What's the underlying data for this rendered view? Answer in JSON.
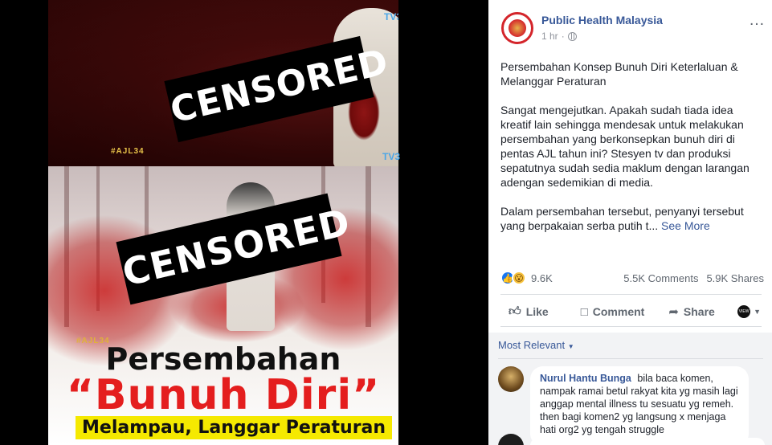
{
  "media": {
    "censor_top": "CENSORED",
    "censor_bottom": "CENSORED",
    "hashtag_top": "#AJL34",
    "hashtag_bottom": "#AJL34",
    "tv_logo": "TV3",
    "headline_line1": "Persembahan",
    "headline_line2": "“Bunuh Diri”",
    "headline_line3": "Melampau, Langgar Peraturan"
  },
  "post": {
    "page_name": "Public Health Malaysia",
    "time": "1 hr",
    "time_separator": "·",
    "more_icon": "…",
    "body_paragraphs": [
      "Persembahan Konsep Bunuh Diri Keterlaluan & Melanggar Peraturan",
      "Sangat mengejutkan. Apakah sudah tiada idea kreatif lain sehingga mendesak untuk melakukan persembahan yang berkonsepkan bunuh diri di pentas AJL tahun ini? Stesyen tv dan produksi sepatutnya sudah sedia maklum dengan larangan adengan sedemikian di media."
    ],
    "body_truncated": "Dalam persembahan tersebut, penyanyi tersebut yang berpakaian serba putih t...",
    "see_more": "See More",
    "reaction_count": "9.6K",
    "comments_count": "5.5K Comments",
    "shares_count": "5.9K Shares",
    "actions": {
      "like": "Like",
      "comment": "Comment",
      "share": "Share"
    },
    "viewer_label": "VIEW"
  },
  "comments": {
    "sort_label": "Most Relevant",
    "items": [
      {
        "author": "Nurul Hantu Bunga",
        "text": "bila baca komen, nampak ramai betul rakyat kita yg masih lagi anggap mental illness tu sesuatu yg remeh. then bagi komen2 yg langsung x menjaga hati org2 yg tengah struggle"
      }
    ]
  },
  "colors": {
    "link_blue": "#385898",
    "like_blue": "#1877f2",
    "headline_red": "#e41e1e",
    "highlight_yellow": "#f5e900",
    "avatar_ring": "#d4252b"
  }
}
